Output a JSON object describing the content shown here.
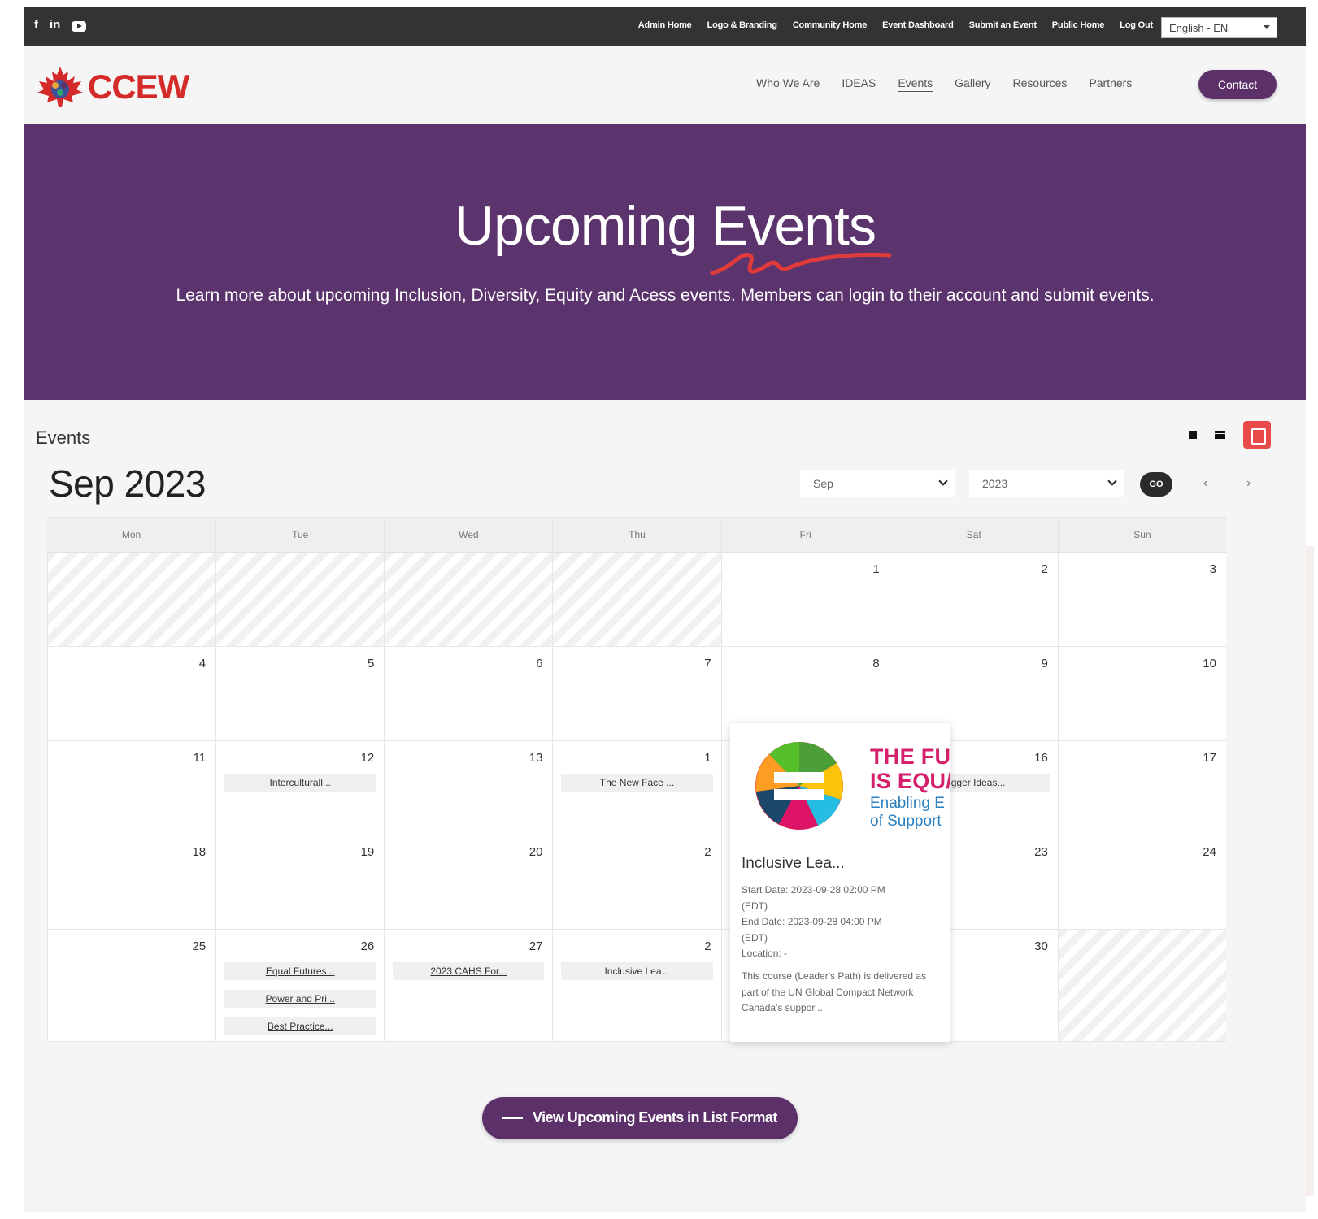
{
  "topbar": {
    "social": [
      "f",
      "in",
      "youtube-icon"
    ],
    "admin_links": [
      "Admin Home",
      "Logo & Branding",
      "Community Home",
      "Event Dashboard",
      "Submit an Event",
      "Public Home",
      "Log Out"
    ],
    "language": "English - EN"
  },
  "header": {
    "logo_text": "CCEW",
    "nav": [
      "Who We Are",
      "IDEAS",
      "Events",
      "Gallery",
      "Resources",
      "Partners"
    ],
    "active_nav": "Events",
    "contact_label": "Contact"
  },
  "hero": {
    "title": "Upcoming Events",
    "subtitle": "Learn more about upcoming Inclusion, Diversity, Equity and Acess events.  Members can login to their account and submit events.",
    "background": "#5c346d",
    "accent": "#e03a3a"
  },
  "events": {
    "label": "Events",
    "month_title": "Sep 2023",
    "month_select": "Sep",
    "year_select": "2023",
    "go_label": "GO",
    "prev": "‹",
    "next": "›"
  },
  "calendar": {
    "weekdays": [
      "Mon",
      "Tue",
      "Wed",
      "Thu",
      "Fri",
      "Sat",
      "Sun"
    ],
    "weeks": [
      [
        {
          "day": ""
        },
        {
          "day": ""
        },
        {
          "day": ""
        },
        {
          "day": ""
        },
        {
          "day": "1"
        },
        {
          "day": "2"
        },
        {
          "day": "3"
        }
      ],
      [
        {
          "day": "4"
        },
        {
          "day": "5"
        },
        {
          "day": "6"
        },
        {
          "day": "7"
        },
        {
          "day": "8"
        },
        {
          "day": "9"
        },
        {
          "day": "10"
        }
      ],
      [
        {
          "day": "11"
        },
        {
          "day": "12",
          "events": [
            "Interculturall..."
          ]
        },
        {
          "day": "13"
        },
        {
          "day": "1",
          "events": [
            "The New Face ..."
          ]
        },
        {
          "day": ""
        },
        {
          "day": "16",
          "events": [
            "Bigger Ideas..."
          ]
        },
        {
          "day": "17"
        }
      ],
      [
        {
          "day": "18"
        },
        {
          "day": "19"
        },
        {
          "day": "20"
        },
        {
          "day": "2"
        },
        {
          "day": ""
        },
        {
          "day": "23"
        },
        {
          "day": "24"
        }
      ],
      [
        {
          "day": "25"
        },
        {
          "day": "26",
          "events": [
            "Equal Futures...",
            "Power and Pri...",
            "Best Practice..."
          ]
        },
        {
          "day": "27",
          "events": [
            "2023 CAHS For..."
          ]
        },
        {
          "day": "2",
          "events": [
            "Inclusive Lea..."
          ]
        },
        {
          "day": ""
        },
        {
          "day": "30"
        },
        {
          "day": ""
        }
      ]
    ]
  },
  "popup": {
    "image_text": [
      "THE FU",
      "IS EQU/",
      "Enabling E",
      "of Support"
    ],
    "title": "Inclusive Lea...",
    "meta": [
      "Start Date: 2023-09-28 02:00 PM",
      "(EDT)",
      "End Date: 2023-09-28 04:00 PM",
      "(EDT)",
      "Location: -"
    ],
    "description": "This course (Leader's Path) is delivered as part of the UN Global Compact Network Canada's suppor..."
  },
  "list_button": {
    "label": "View Upcoming Events in List Format"
  }
}
